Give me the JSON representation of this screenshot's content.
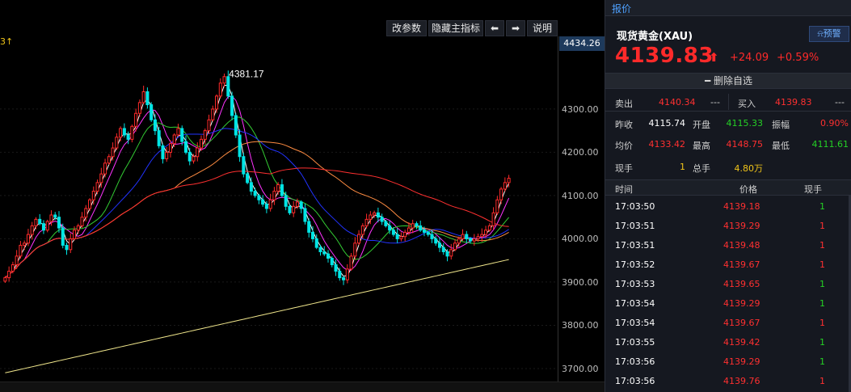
{
  "toolbar": {
    "edit_params": "改参数",
    "hide_main_indicator": "隐藏主指标",
    "prev_label": "⬅",
    "next_label": "➡",
    "help": "说明"
  },
  "chart": {
    "corner_label": "3↑",
    "current_price_tag": "4434.26",
    "peak_label": "4381.17",
    "y_ticks": [
      "4300.00",
      "4200.00",
      "4100.00",
      "4000.00",
      "3900.00",
      "3800.00",
      "3700.00"
    ],
    "colors": {
      "up": "#ff2a2a",
      "down": "#00e5e5",
      "ma_white": "#ffffff",
      "ma_yellow": "#f0e68c",
      "ma_magenta": "#ff33ff",
      "ma_green": "#33cc33",
      "ma_blue": "#2233ff",
      "ma_orange": "#ff8c42",
      "ma_red": "#ff3030"
    }
  },
  "chart_data": {
    "type": "candlestick",
    "ylim": [
      3670,
      4440
    ],
    "peak": 4381.17,
    "close_series": [
      3910,
      3925,
      3940,
      3960,
      3985,
      3990,
      4010,
      4030,
      4045,
      4035,
      4020,
      4040,
      4055,
      4050,
      4025,
      3985,
      3975,
      4000,
      4020,
      4030,
      4050,
      4070,
      4090,
      4110,
      4130,
      4150,
      4175,
      4190,
      4210,
      4235,
      4255,
      4240,
      4230,
      4260,
      4290,
      4315,
      4340,
      4310,
      4275,
      4250,
      4215,
      4185,
      4200,
      4220,
      4240,
      4255,
      4225,
      4200,
      4180,
      4190,
      4210,
      4230,
      4250,
      4275,
      4300,
      4330,
      4360,
      4375,
      4330,
      4285,
      4240,
      4190,
      4150,
      4130,
      4110,
      4100,
      4090,
      4080,
      4070,
      4090,
      4110,
      4125,
      4100,
      4075,
      4060,
      4075,
      4085,
      4070,
      4040,
      4015,
      4000,
      3980,
      3970,
      3965,
      3955,
      3940,
      3925,
      3910,
      3905,
      3930,
      3960,
      3990,
      4010,
      4030,
      4045,
      4055,
      4060,
      4050,
      4040,
      4030,
      4020,
      4010,
      4000,
      4005,
      4015,
      4025,
      4035,
      4030,
      4020,
      4015,
      4010,
      4000,
      3990,
      3980,
      3970,
      3960,
      3975,
      3990,
      4000,
      4010,
      4000,
      3995,
      4000,
      4005,
      4010,
      4020,
      4030,
      4060,
      4090,
      4115,
      4130,
      4139.83
    ]
  },
  "panel": {
    "tab": "报价",
    "symbol": "现货黄金(XAU)",
    "alert": "预警",
    "price": "4139.83",
    "change": "+24.09",
    "change_pct": "+0.59%",
    "remove_label": "删除自选",
    "sell_label": "卖出",
    "sell_value": "4140.34",
    "sell_extra": "---",
    "buy_label": "买入",
    "buy_value": "4139.83",
    "buy_extra": "---",
    "stats": [
      [
        {
          "k": "昨收",
          "v": "4115.74",
          "c": "white"
        },
        {
          "k": "开盘",
          "v": "4115.33",
          "c": "green"
        },
        {
          "k": "振幅",
          "v": "0.90%",
          "c": "red"
        }
      ],
      [
        {
          "k": "均价",
          "v": "4133.42",
          "c": "red"
        },
        {
          "k": "最高",
          "v": "4148.75",
          "c": "red"
        },
        {
          "k": "最低",
          "v": "4111.61",
          "c": "green"
        }
      ],
      [
        {
          "k": "现手",
          "v": "1",
          "c": "yellow"
        },
        {
          "k": "总手",
          "v": "4.80万",
          "c": "yellow"
        }
      ]
    ],
    "trade_headers": [
      "时间",
      "价格",
      "现手"
    ],
    "trades": [
      {
        "t": "17:03:50",
        "p": "4139.18",
        "v": "1",
        "c": "green"
      },
      {
        "t": "17:03:51",
        "p": "4139.29",
        "v": "1",
        "c": "red"
      },
      {
        "t": "17:03:51",
        "p": "4139.48",
        "v": "1",
        "c": "red"
      },
      {
        "t": "17:03:52",
        "p": "4139.67",
        "v": "1",
        "c": "red"
      },
      {
        "t": "17:03:53",
        "p": "4139.65",
        "v": "1",
        "c": "green"
      },
      {
        "t": "17:03:54",
        "p": "4139.29",
        "v": "1",
        "c": "green"
      },
      {
        "t": "17:03:54",
        "p": "4139.67",
        "v": "1",
        "c": "red"
      },
      {
        "t": "17:03:55",
        "p": "4139.42",
        "v": "1",
        "c": "green"
      },
      {
        "t": "17:03:56",
        "p": "4139.29",
        "v": "1",
        "c": "green"
      },
      {
        "t": "17:03:56",
        "p": "4139.76",
        "v": "1",
        "c": "red"
      }
    ]
  }
}
